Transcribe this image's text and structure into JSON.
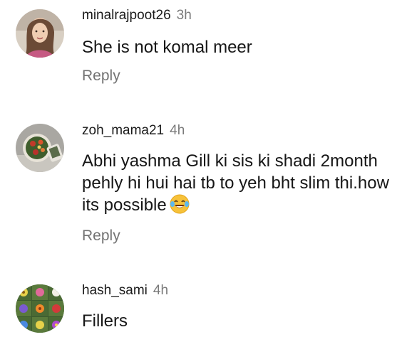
{
  "comments": [
    {
      "username": "minalrajpoot26",
      "time": "3h",
      "text": "She is not komal meer",
      "reply_label": "Reply",
      "avatar_icon": "user-photo-avatar"
    },
    {
      "username": "zoh_mama21",
      "time": "4h",
      "text": "Abhi yashma Gill ki sis ki shadi 2month pehly hi hui hai tb to yeh bht slim thi.how its possible",
      "emoji": "laughing-tears-emoji",
      "reply_label": "Reply",
      "avatar_icon": "food-photo-avatar"
    },
    {
      "username": "hash_sami",
      "time": "4h",
      "text": "Fillers",
      "avatar_icon": "flowers-grid-avatar"
    }
  ],
  "colors": {
    "username": "#1a1a1a",
    "timestamp": "#7a7a7a",
    "reply": "#737373",
    "body_text": "#161616",
    "background": "#ffffff"
  }
}
